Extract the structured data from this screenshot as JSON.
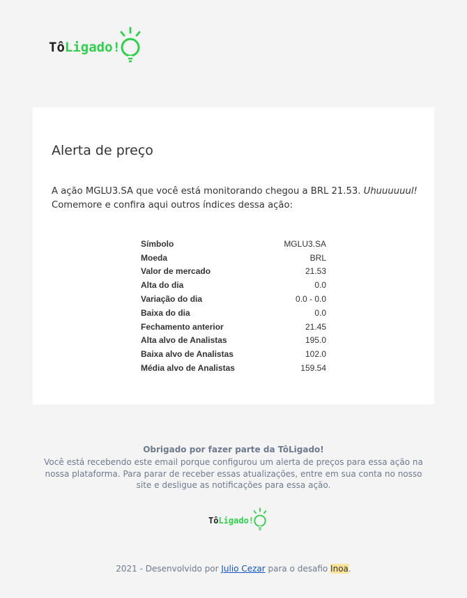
{
  "brand": {
    "prefix": "Tô",
    "suffix": "Ligado!",
    "icon": "lightbulb-icon",
    "accent_color": "#2fd14b"
  },
  "alert": {
    "title": "Alerta de preço",
    "message_before": "A ação MGLU3.SA que você está monitorando chegou a BRL 21.53. ",
    "message_emphasis": "Uhuuuuuul!",
    "message_after": " Comemore e confira aqui outros índices dessa ação:"
  },
  "indices": [
    {
      "label": "Símbolo",
      "value": "MGLU3.SA"
    },
    {
      "label": "Moeda",
      "value": "BRL"
    },
    {
      "label": "Valor de mercado",
      "value": "21.53"
    },
    {
      "label": "Alta do dia",
      "value": "0.0"
    },
    {
      "label": "Variação do dia",
      "value": "0.0 - 0.0"
    },
    {
      "label": "Baixa do dia",
      "value": "0.0"
    },
    {
      "label": "Fechamento anterior",
      "value": "21.45"
    },
    {
      "label": "Alta alvo de Analistas",
      "value": "195.0"
    },
    {
      "label": "Baixa alvo de Analistas",
      "value": "102.0"
    },
    {
      "label": "Média alvo de Analistas",
      "value": "159.54"
    }
  ],
  "footer": {
    "thanks": "Obrigado por fazer parte da TôLigado!",
    "notice": "Você está recebendo este email porque configurou um alerta de preços para essa ação na nossa plataforma. Para parar de receber essas atualizações, entre em sua conta no nosso site e desligue as notificações para essa ação.",
    "credit_before": "2021 - Desenvolvido por ",
    "author_link": "Julio Cezar",
    "credit_middle": " para o desafio ",
    "challenge": "Inoa",
    "credit_after": ".",
    "link_color": "#1155cc",
    "highlight_color": "#fde39a"
  }
}
